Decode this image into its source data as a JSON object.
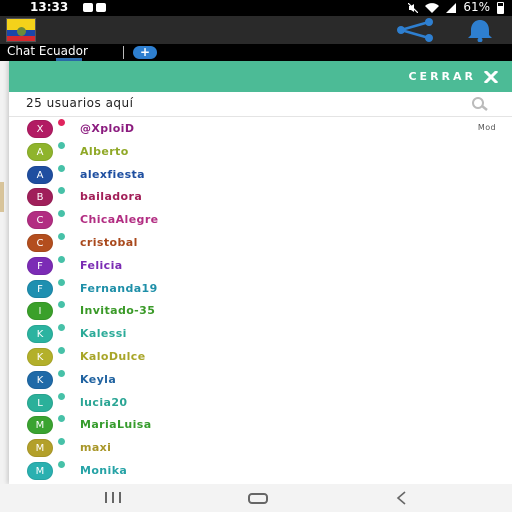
{
  "status_bar": {
    "time": "13:33",
    "battery": "61%"
  },
  "app_bar": {
    "flag": "ecuador-flag"
  },
  "tab": {
    "label": "Chat Ecuador",
    "add_label": "+"
  },
  "panel": {
    "close_label": "CERRAR",
    "user_count": "25 usuarios aquí",
    "accent_color": "#4cbb96"
  },
  "users": [
    {
      "initial": "X",
      "name": "@XploiD",
      "avatar_color": "#b21b63",
      "name_color": "#8b1c7f",
      "status_color": "#e0245e",
      "badge": "Mod"
    },
    {
      "initial": "A",
      "name": "Alberto",
      "avatar_color": "#8fb42c",
      "name_color": "#8fa826",
      "status_color": "#47c1a8",
      "badge": ""
    },
    {
      "initial": "A",
      "name": "alexfiesta",
      "avatar_color": "#1f4ea0",
      "name_color": "#1d4ea0",
      "status_color": "#47c1a8",
      "badge": ""
    },
    {
      "initial": "B",
      "name": "bailadora",
      "avatar_color": "#a01f5a",
      "name_color": "#a21f58",
      "status_color": "#47c1a8",
      "badge": ""
    },
    {
      "initial": "C",
      "name": "ChicaAlegre",
      "avatar_color": "#b22d82",
      "name_color": "#b22d82",
      "status_color": "#47c1a8",
      "badge": ""
    },
    {
      "initial": "C",
      "name": "cristobal",
      "avatar_color": "#b34e1e",
      "name_color": "#a9491c",
      "status_color": "#47c1a8",
      "badge": ""
    },
    {
      "initial": "F",
      "name": "Felicia",
      "avatar_color": "#7b2bb5",
      "name_color": "#7a2bb3",
      "status_color": "#47c1a8",
      "badge": ""
    },
    {
      "initial": "F",
      "name": "Fernanda19",
      "avatar_color": "#1e8fb0",
      "name_color": "#1e8fa8",
      "status_color": "#47c1a8",
      "badge": ""
    },
    {
      "initial": "I",
      "name": "Invitado-35",
      "avatar_color": "#3aa02a",
      "name_color": "#3a9a28",
      "status_color": "#47c1a8",
      "badge": ""
    },
    {
      "initial": "K",
      "name": "Kalessi",
      "avatar_color": "#2bb3a0",
      "name_color": "#2aaa98",
      "status_color": "#47c1a8",
      "badge": ""
    },
    {
      "initial": "K",
      "name": "KaloDulce",
      "avatar_color": "#b3b02a",
      "name_color": "#a8a528",
      "status_color": "#47c1a8",
      "badge": ""
    },
    {
      "initial": "K",
      "name": "Keyla",
      "avatar_color": "#1f6aa8",
      "name_color": "#1f62a0",
      "status_color": "#47c1a8",
      "badge": ""
    },
    {
      "initial": "L",
      "name": "lucia20",
      "avatar_color": "#2bb09a",
      "name_color": "#2aa594",
      "status_color": "#47c1a8",
      "badge": ""
    },
    {
      "initial": "M",
      "name": "MariaLuisa",
      "avatar_color": "#3aa330",
      "name_color": "#359c2c",
      "status_color": "#47c1a8",
      "badge": ""
    },
    {
      "initial": "M",
      "name": "maxi",
      "avatar_color": "#b3a02a",
      "name_color": "#a89628",
      "status_color": "#47c1a8",
      "badge": ""
    },
    {
      "initial": "M",
      "name": "Monika",
      "avatar_color": "#2ab0b0",
      "name_color": "#26a3a6",
      "status_color": "#47c1a8",
      "badge": ""
    }
  ]
}
